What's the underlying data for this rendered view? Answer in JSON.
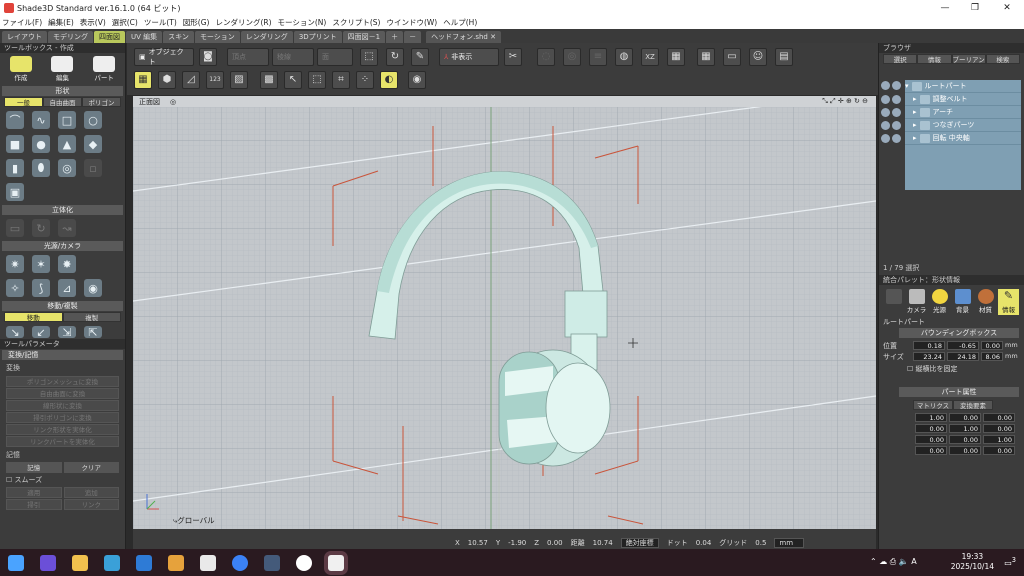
{
  "window": {
    "title": "Shade3D Standard ver.16.1.0 (64 ビット)",
    "minimize": "—",
    "restore": "❐",
    "close": "✕"
  },
  "menu": [
    "ファイル(F)",
    "編集(E)",
    "表示(V)",
    "選択(C)",
    "ツール(T)",
    "図形(G)",
    "レンダリング(R)",
    "モーション(N)",
    "スクリプト(S)",
    "ウインドウ(W)",
    "ヘルプ(H)"
  ],
  "tabs": [
    "レイアウト",
    "モデリング",
    "四面図",
    "UV 編集",
    "スキン",
    "モーション",
    "レンダリング",
    "3Dプリント",
    "四面図－1",
    "＋",
    "－"
  ],
  "active_tab": "四面図",
  "file_tab": {
    "label": "ヘッドフォン.shd",
    "close": "✕"
  },
  "left": {
    "toolbox_title": "ツールボックス - 作成",
    "modes": [
      "作成",
      "編集",
      "パート"
    ],
    "shape_section": "形状",
    "shape_tabs": [
      "一般",
      "自由曲面",
      "ポリゴン"
    ],
    "solid_section": "立体化",
    "light_section": "光源/カメラ",
    "move_section": "移動/複製",
    "move_tabs": [
      "移動",
      "複製"
    ],
    "param_title": "ツールパラメータ",
    "param_sub": "変換/記憶",
    "convert_label": "変換",
    "convert_buttons": [
      "ポリゴンメッシュに変換",
      "自由曲面に変換",
      "線形状に変換",
      "掃引ポリゴンに変換",
      "リンク形状を実体化",
      "リンクパートを実体化"
    ],
    "memory_label": "記憶",
    "memory_buttons": [
      "記憶",
      "クリア"
    ],
    "smooth_label": "スムーズ",
    "smooth_buttons": [
      "適用",
      "追加",
      "掃引",
      "リンク"
    ]
  },
  "toolbar": {
    "object_label": "オブジェクト",
    "vertex_label": "頂点",
    "edge_label": "稜線",
    "face_label": "面",
    "hide_label": "非表示"
  },
  "viewport": {
    "view_name": "正面図",
    "global_label": "グローバル"
  },
  "status": {
    "x_label": "X",
    "x_val": "10.57",
    "y_label": "Y",
    "y_val": "-1.90",
    "z_label": "Z",
    "z_val": "0.00",
    "dist_label": "距離",
    "dist_val": "10.74",
    "coord_mode": "絶対座標",
    "dot_label": "ドット",
    "dot_val": "0.04",
    "grid_label": "グリッド",
    "grid_val": "0.5",
    "unit": "mm"
  },
  "browser": {
    "title": "ブラウザ",
    "tabs": [
      "選択",
      "情報",
      "ブーリアン",
      "検索"
    ],
    "items": [
      "ルートパート",
      "調整ベルト",
      "アーチ",
      "つなぎパーツ",
      "回転 中央軸"
    ],
    "selection": "1 / 79 選択"
  },
  "integrated": {
    "title": "統合パレット：形状情報",
    "tabs": [
      "カメラ",
      "光源",
      "背景",
      "材質",
      "情報"
    ],
    "part_name": "ルートパート",
    "bbox_label": "バウンディングボックス",
    "pos_label": "位置",
    "pos": [
      "0.18",
      "-0.65",
      "0.00"
    ],
    "size_label": "サイズ",
    "size": [
      "23.24",
      "24.18",
      "8.06"
    ],
    "unit": "mm",
    "ratio_label": "縦横比を固定",
    "part_attr_label": "パート属性",
    "matrix_tabs": [
      "マトリクス",
      "変換要素"
    ],
    "matrix": [
      [
        "1.00",
        "0.00",
        "0.00"
      ],
      [
        "0.00",
        "1.00",
        "0.00"
      ],
      [
        "0.00",
        "0.00",
        "1.00"
      ],
      [
        "0.00",
        "0.00",
        "0.00"
      ]
    ]
  },
  "taskbar": {
    "time": "19:33",
    "date": "2025/10/14",
    "ime": "A",
    "notif": "3"
  }
}
